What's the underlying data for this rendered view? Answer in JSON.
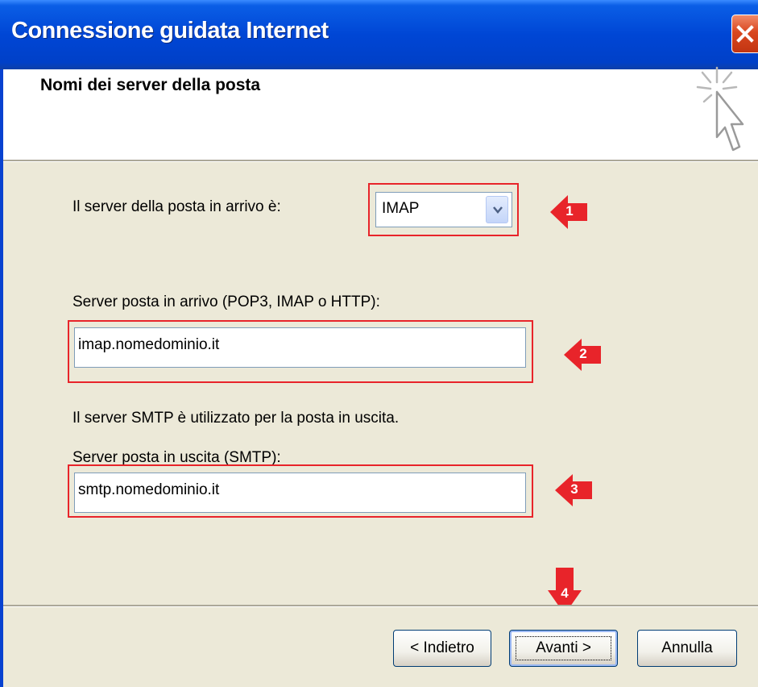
{
  "window": {
    "title": "Connessione guidata Internet"
  },
  "header": {
    "title": "Nomi dei server della posta"
  },
  "form": {
    "incoming_type_label": "Il server della posta in arrivo è:",
    "incoming_type_value": "IMAP",
    "incoming_server_label": "Server posta in arrivo (POP3, IMAP o HTTP):",
    "incoming_server_value": "imap.nomedominio.it",
    "smtp_note": "Il server SMTP è utilizzato per la posta in uscita.",
    "outgoing_server_label": "Server posta in uscita (SMTP):",
    "outgoing_server_value": "smtp.nomedominio.it"
  },
  "callouts": [
    "1",
    "2",
    "3",
    "4"
  ],
  "buttons": {
    "back": "< Indietro",
    "next": "Avanti >",
    "cancel": "Annulla"
  },
  "colors": {
    "titlebar": "#0046d5",
    "highlight": "#e8242a",
    "dialog_bg": "#ece9d8"
  }
}
